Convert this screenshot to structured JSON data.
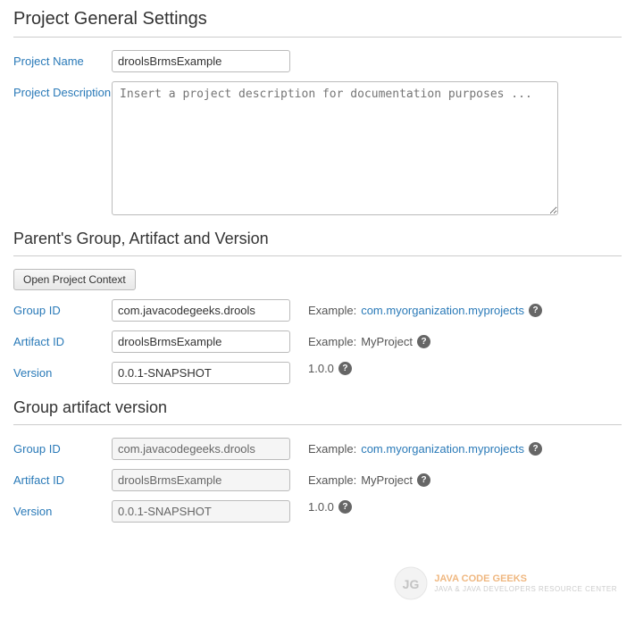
{
  "page": {
    "title": "Project General Settings"
  },
  "project_general": {
    "section_title": "Project General Settings",
    "name_label": "Project Name",
    "name_value": "droolsBrmsExample",
    "description_label": "Project Description",
    "description_placeholder": "Insert a project description for documentation purposes ..."
  },
  "parents_group": {
    "section_title": "Parent's Group, Artifact and Version",
    "open_context_btn": "Open Project Context",
    "group_id_label": "Group ID",
    "group_id_value": "com.javacodegeeks.drools",
    "group_id_example_prefix": "Example:",
    "group_id_example_value": "com.myorganization.myprojects",
    "artifact_id_label": "Artifact ID",
    "artifact_id_value": "droolsBrmsExample",
    "artifact_id_example_prefix": "Example:",
    "artifact_id_example_value": "MyProject",
    "version_label": "Version",
    "version_value": "0.0.1-SNAPSHOT",
    "version_static": "1.0.0"
  },
  "group_artifact": {
    "section_title": "Group artifact version",
    "group_id_label": "Group ID",
    "group_id_value": "com.javacodegeeks.drools",
    "group_id_example_prefix": "Example:",
    "group_id_example_value": "com.myorganization.myprojects",
    "artifact_id_label": "Artifact ID",
    "artifact_id_value": "droolsBrmsExample",
    "artifact_id_example_prefix": "Example:",
    "artifact_id_example_value": "MyProject",
    "version_label": "Version",
    "version_value": "0.0.1-SNAPSHOT",
    "version_static": "1.0.0"
  },
  "icons": {
    "help": "?"
  }
}
